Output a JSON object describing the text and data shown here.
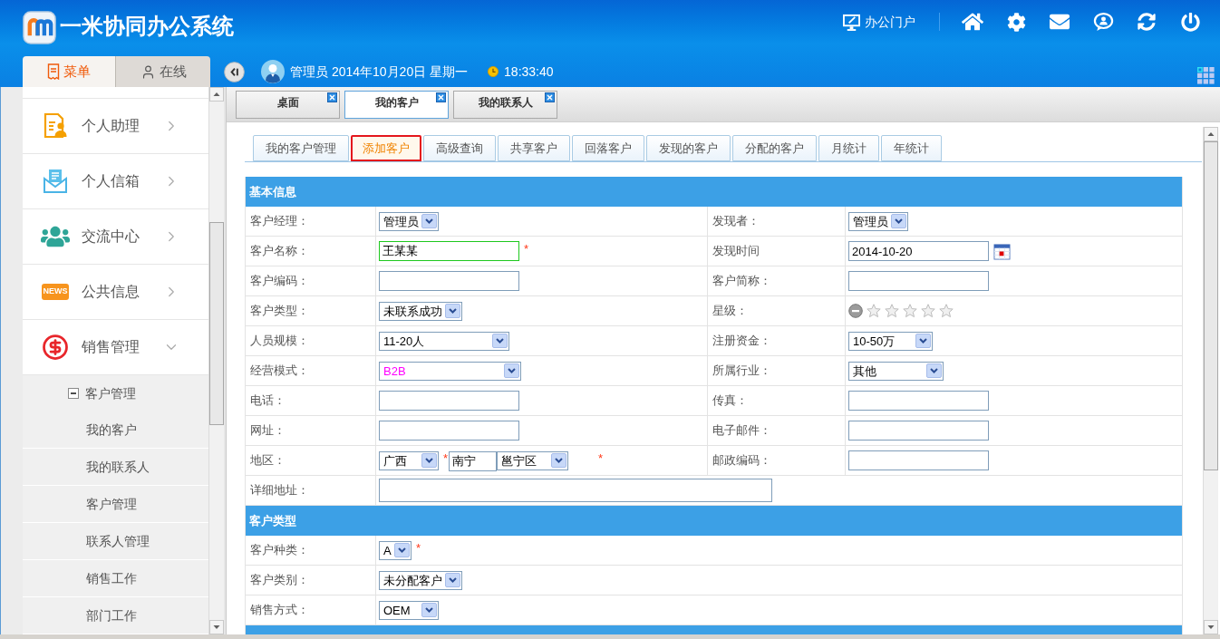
{
  "header": {
    "title": "一米协同办公系统",
    "portal_link": "办公门户"
  },
  "sidebar": {
    "tabs": [
      {
        "label": "菜单",
        "selected": true
      },
      {
        "label": "在线",
        "selected": false
      }
    ],
    "menu": [
      {
        "label": "个人助理",
        "expanded": false
      },
      {
        "label": "个人信箱",
        "expanded": false
      },
      {
        "label": "交流中心",
        "expanded": false
      },
      {
        "label": "公共信息",
        "expanded": false,
        "badge": "NEWS"
      },
      {
        "label": "销售管理",
        "expanded": true,
        "children": [
          {
            "label": "客户管理",
            "expanded": true,
            "children": [
              {
                "label": "我的客户"
              },
              {
                "label": "我的联系人"
              },
              {
                "label": "客户管理"
              },
              {
                "label": "联系人管理"
              },
              {
                "label": "销售工作"
              },
              {
                "label": "部门工作"
              }
            ]
          }
        ]
      }
    ]
  },
  "user_bar": {
    "info": "管理员 2014年10月20日 星期一",
    "time": "18:33:40"
  },
  "page_tabs": [
    {
      "label": "桌面",
      "selected": false
    },
    {
      "label": "我的客户",
      "selected": true
    },
    {
      "label": "我的联系人",
      "selected": false
    }
  ],
  "sub_tabs": [
    {
      "label": "我的客户管理",
      "selected": false
    },
    {
      "label": "添加客户",
      "selected": true
    },
    {
      "label": "高级查询",
      "selected": false
    },
    {
      "label": "共享客户",
      "selected": false
    },
    {
      "label": "回落客户",
      "selected": false
    },
    {
      "label": "发现的客户",
      "selected": false
    },
    {
      "label": "分配的客户",
      "selected": false
    },
    {
      "label": "月统计",
      "selected": false
    },
    {
      "label": "年统计",
      "selected": false
    }
  ],
  "form": {
    "sections": [
      {
        "title": "基本信息",
        "rows": [
          {
            "fields": [
              {
                "label": "客户经理：",
                "kind": "select",
                "value": "管理员"
              },
              {
                "label": "发现者：",
                "kind": "select",
                "value": "管理员"
              }
            ]
          },
          {
            "fields": [
              {
                "label": "客户名称：",
                "kind": "text",
                "value": "王某某",
                "focused": true,
                "mark": "*"
              },
              {
                "label": "发现时间",
                "kind": "date",
                "value": "2014-10-20",
                "focused": false
              }
            ]
          },
          {
            "fields": [
              {
                "label": "客户编码：",
                "kind": "text",
                "focused": false
              },
              {
                "label": "客户简称：",
                "kind": "text",
                "focused": false
              }
            ]
          },
          {
            "fields": [
              {
                "label": "客户类型：",
                "kind": "select",
                "value": "未联系成功"
              },
              {
                "label": "星级：",
                "kind": "stars",
                "stars": 0
              }
            ]
          },
          {
            "fields": [
              {
                "label": "人员规模：",
                "kind": "select",
                "value": "11-20人"
              },
              {
                "label": "注册资金：",
                "kind": "select",
                "value": "10-50万"
              }
            ]
          },
          {
            "fields": [
              {
                "label": "经营模式：",
                "kind": "select",
                "value": "B2B",
                "color": "#ff00ff"
              },
              {
                "label": "所属行业：",
                "kind": "select",
                "value": "其他"
              }
            ]
          },
          {
            "fields": [
              {
                "label": "电话：",
                "kind": "text",
                "focused": false
              },
              {
                "label": "传真：",
                "kind": "text",
                "focused": false
              }
            ]
          },
          {
            "fields": [
              {
                "label": "网址：",
                "kind": "text",
                "focused": false
              },
              {
                "label": "电子邮件：",
                "kind": "text",
                "focused": false
              }
            ]
          },
          {
            "fields": [
              {
                "label": "地区：",
                "kind": "region",
                "parts": [
                  {
                    "kind": "select",
                    "value": "广西"
                  },
                  {
                    "kind": "mark",
                    "text": "*"
                  },
                  {
                    "kind": "text",
                    "value": "南宁",
                    "focused": false
                  },
                  {
                    "kind": "select",
                    "value": "邕宁区"
                  },
                  {
                    "kind": "mark",
                    "text": "*"
                  }
                ]
              },
              {
                "label": "邮政编码：",
                "kind": "text",
                "focused": false
              }
            ]
          },
          {
            "fields": [
              {
                "label": "详细地址：",
                "kind": "text",
                "focused": false
              }
            ]
          }
        ]
      },
      {
        "title": "客户类型",
        "rows": [
          {
            "fields": [
              {
                "label": "客户种类：",
                "kind": "select",
                "value": "A",
                "mark": "*"
              }
            ]
          },
          {
            "fields": [
              {
                "label": "客户类别：",
                "kind": "select",
                "value": "未分配客户"
              }
            ]
          },
          {
            "fields": [
              {
                "label": "销售方式：",
                "kind": "select",
                "value": "OEM"
              }
            ]
          }
        ]
      }
    ]
  }
}
